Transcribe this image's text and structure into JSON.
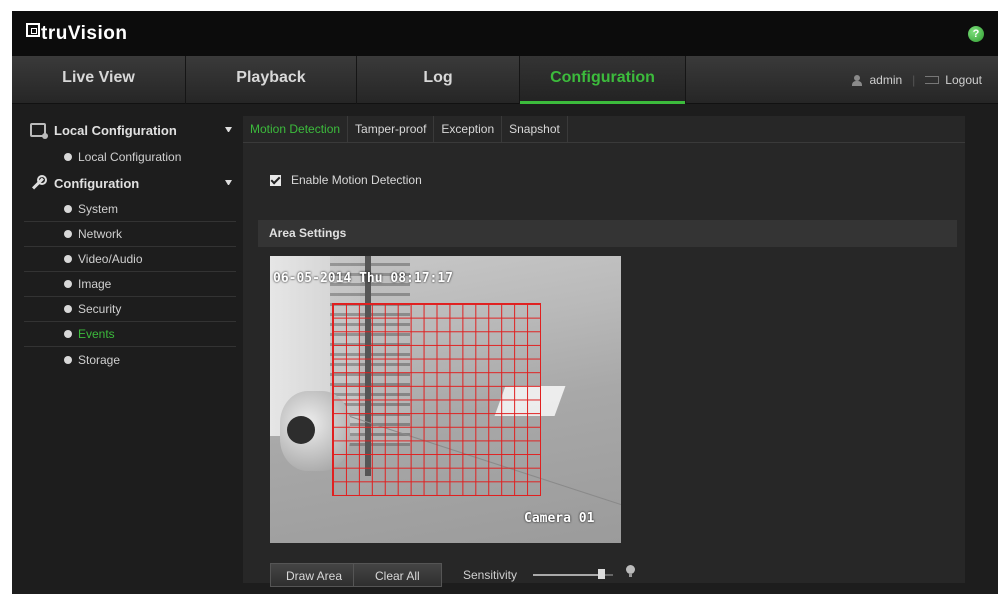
{
  "app": {
    "logo_text": "truVision",
    "help_label": "?"
  },
  "nav": {
    "tabs": [
      {
        "label": "Live View"
      },
      {
        "label": "Playback"
      },
      {
        "label": "Log"
      },
      {
        "label": "Configuration",
        "active": true
      }
    ],
    "user": "admin",
    "separator": "|",
    "logout": "Logout"
  },
  "sidebar": {
    "local_group": "Local Configuration",
    "local_items": [
      "Local Configuration"
    ],
    "config_group": "Configuration",
    "config_items": [
      "System",
      "Network",
      "Video/Audio",
      "Image",
      "Security",
      "Events",
      "Storage"
    ],
    "active_item": "Events"
  },
  "content": {
    "subtabs": [
      "Motion Detection",
      "Tamper-proof",
      "Exception",
      "Snapshot"
    ],
    "active_subtab": "Motion Detection",
    "enable_label": "Enable Motion Detection",
    "enable_checked": true,
    "area_header": "Area Settings",
    "camera": {
      "timestamp": "06-05-2014 Thu 08:17:17",
      "camera_name": "Camera 01",
      "grid_columns": 16,
      "grid_rows": 14
    },
    "draw_area_label": "Draw Area",
    "clear_all_label": "Clear All",
    "sensitivity_label": "Sensitivity",
    "sensitivity_value": 0.85
  },
  "colors": {
    "accent": "#3cbb3c",
    "grid": "#e02020"
  }
}
